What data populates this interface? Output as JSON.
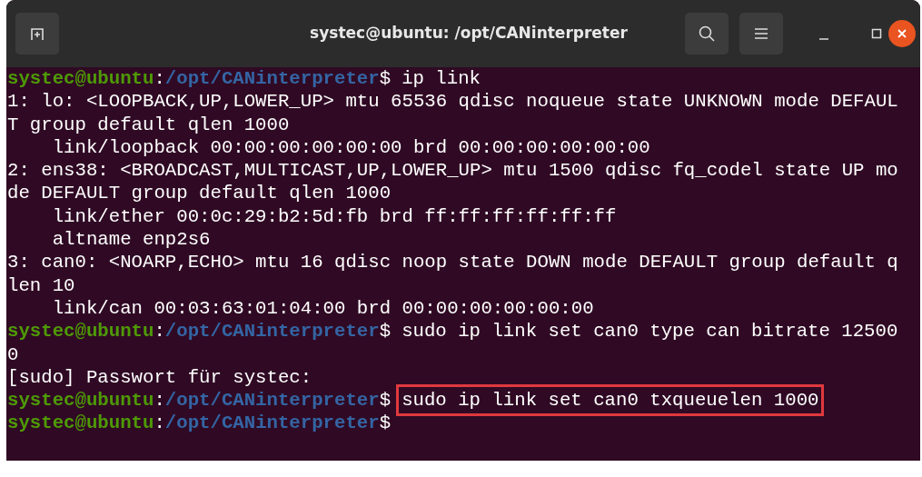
{
  "window": {
    "title": "systec@ubuntu: /opt/CANinterpreter"
  },
  "terminal": {
    "lines": [
      {
        "kind": "prompt",
        "user": "systec@ubuntu",
        "separator": ":",
        "path": "/opt/CANinterpreter",
        "prompt_end": "$",
        "command": "ip link",
        "highlighted": false
      },
      {
        "kind": "output",
        "text": "1: lo: <LOOPBACK,UP,LOWER_UP> mtu 65536 qdisc noqueue state UNKNOWN mode DEFAUL"
      },
      {
        "kind": "output",
        "text": "T group default qlen 1000"
      },
      {
        "kind": "output",
        "text": "    link/loopback 00:00:00:00:00:00 brd 00:00:00:00:00:00"
      },
      {
        "kind": "output",
        "text": "2: ens38: <BROADCAST,MULTICAST,UP,LOWER_UP> mtu 1500 qdisc fq_codel state UP mo"
      },
      {
        "kind": "output",
        "text": "de DEFAULT group default qlen 1000"
      },
      {
        "kind": "output",
        "text": "    link/ether 00:0c:29:b2:5d:fb brd ff:ff:ff:ff:ff:ff"
      },
      {
        "kind": "output",
        "text": "    altname enp2s6"
      },
      {
        "kind": "output",
        "text": "3: can0: <NOARP,ECHO> mtu 16 qdisc noop state DOWN mode DEFAULT group default q"
      },
      {
        "kind": "output",
        "text": "len 10"
      },
      {
        "kind": "output",
        "text": "    link/can 00:03:63:01:04:00 brd 00:00:00:00:00:00"
      },
      {
        "kind": "prompt",
        "user": "systec@ubuntu",
        "separator": ":",
        "path": "/opt/CANinterpreter",
        "prompt_end": "$",
        "command": "sudo ip link set can0 type can bitrate 12500",
        "highlighted": false
      },
      {
        "kind": "output",
        "text": "0"
      },
      {
        "kind": "output",
        "text": "[sudo] Passwort für systec:"
      },
      {
        "kind": "prompt",
        "user": "systec@ubuntu",
        "separator": ":",
        "path": "/opt/CANinterpreter",
        "prompt_end": "$",
        "command": "sudo ip link set can0 txqueuelen 1000",
        "highlighted": true
      },
      {
        "kind": "prompt",
        "user": "systec@ubuntu",
        "separator": ":",
        "path": "/opt/CANinterpreter",
        "prompt_end": "$"
      }
    ]
  }
}
